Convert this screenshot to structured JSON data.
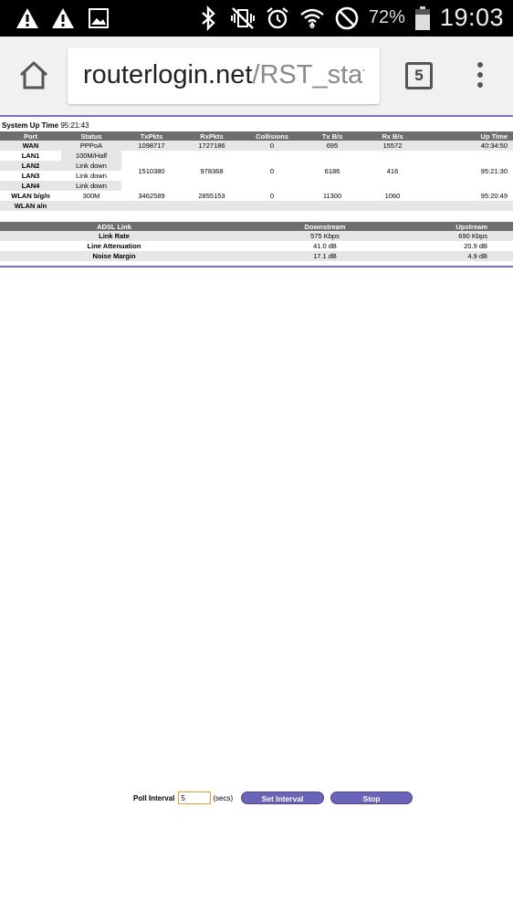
{
  "statusbar": {
    "battery_pct": "72%",
    "time": "19:03"
  },
  "browser": {
    "url_host": "routerlogin.net",
    "url_path": "/RST_statis",
    "tab_count": "5"
  },
  "system": {
    "uptime_label": "System Up Time",
    "uptime_value": "95:21:43"
  },
  "stats_table": {
    "headers": [
      "Port",
      "Status",
      "TxPkts",
      "RxPkts",
      "Collisions",
      "Tx B/s",
      "Rx B/s",
      "Up Time"
    ],
    "wan": {
      "port": "WAN",
      "status": "PPPoA",
      "txpkts": "1098717",
      "rxpkts": "1727186",
      "collisions": "0",
      "txbs": "695",
      "rxbs": "15572",
      "uptime": "40:34:50"
    },
    "lan": {
      "ports": [
        {
          "port": "LAN1",
          "status": "100M/Half"
        },
        {
          "port": "LAN2",
          "status": "Link down"
        },
        {
          "port": "LAN3",
          "status": "Link down"
        },
        {
          "port": "LAN4",
          "status": "Link down"
        }
      ],
      "txpkts": "1510380",
      "rxpkts": "978368",
      "collisions": "0",
      "txbs": "6186",
      "rxbs": "416",
      "uptime": "95:21:30"
    },
    "wlan_bgn": {
      "port": "WLAN b/g/n",
      "status": "300M",
      "txpkts": "3462589",
      "rxpkts": "2855153",
      "collisions": "0",
      "txbs": "11300",
      "rxbs": "1060",
      "uptime": "95:20:49"
    },
    "wlan_an": {
      "port": "WLAN a/n"
    }
  },
  "adsl_table": {
    "headers": [
      "ADSL Link",
      "Downstream",
      "Upstream"
    ],
    "rows": [
      {
        "label": "Link Rate",
        "down": "575 Kbps",
        "up": "690 Kbps"
      },
      {
        "label": "Line Attenuation",
        "down": "41.0 dB",
        "up": "20.9 dB"
      },
      {
        "label": "Noise Margin",
        "down": "17.1 dB",
        "up": "4.9 dB"
      }
    ]
  },
  "poll": {
    "label": "Poll Interval",
    "value": "5",
    "unit": "(secs)",
    "set_button": "Set Interval",
    "stop_button": "Stop"
  }
}
